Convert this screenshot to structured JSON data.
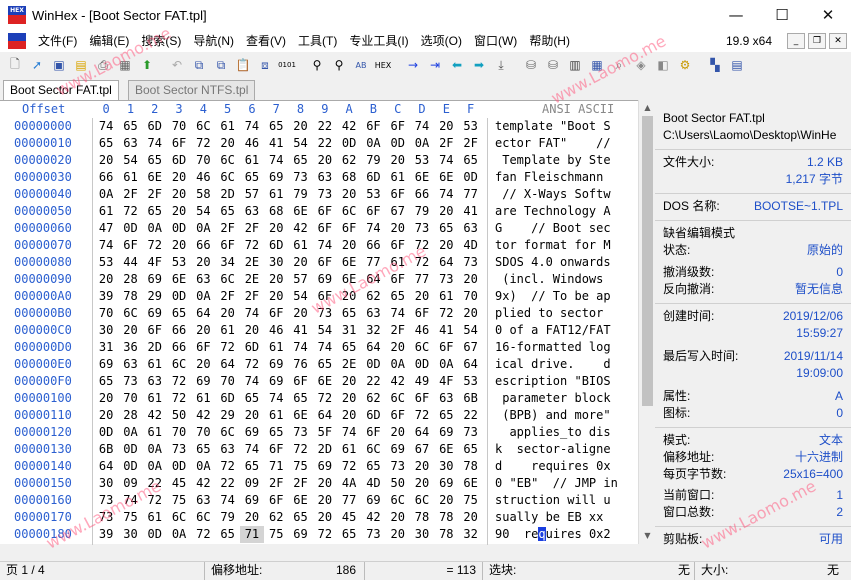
{
  "window": {
    "title": "WinHex - [Boot Sector FAT.tpl]",
    "icon_text": "HEX"
  },
  "menu": {
    "items": [
      "文件(F)",
      "编辑(E)",
      "搜索(S)",
      "导航(N)",
      "查看(V)",
      "工具(T)",
      "专业工具(I)",
      "选项(O)",
      "窗口(W)",
      "帮助(H)"
    ],
    "version": "19.9 x64"
  },
  "tabs": [
    "Boot Sector FAT.tpl",
    "Boot Sector NTFS.tpl"
  ],
  "hex": {
    "offset_header": "Offset",
    "col_headers": [
      "0",
      "1",
      "2",
      "3",
      "4",
      "5",
      "6",
      "7",
      "8",
      "9",
      "A",
      "B",
      "C",
      "D",
      "E",
      "F"
    ],
    "ansi_header": "ANSI ASCII",
    "offsets": [
      "00000000",
      "00000010",
      "00000020",
      "00000030",
      "00000040",
      "00000050",
      "00000060",
      "00000070",
      "00000080",
      "00000090",
      "000000A0",
      "000000B0",
      "000000C0",
      "000000D0",
      "000000E0",
      "000000F0",
      "00000100",
      "00000110",
      "00000120",
      "00000130",
      "00000140",
      "00000150",
      "00000160",
      "00000170",
      "00000180"
    ],
    "rows": [
      "74 65 6D 70 6C 61 74 65 20 22 42 6F 6F 74 20 53",
      "65 63 74 6F 72 20 46 41 54 22 0D 0A 0D 0A 2F 2F",
      "20 54 65 6D 70 6C 61 74 65 20 62 79 20 53 74 65",
      "66 61 6E 20 46 6C 65 69 73 63 68 6D 61 6E 6E 0D",
      "0A 2F 2F 20 58 2D 57 61 79 73 20 53 6F 66 74 77",
      "61 72 65 20 54 65 63 68 6E 6F 6C 6F 67 79 20 41",
      "47 0D 0A 0D 0A 2F 2F 20 42 6F 6F 74 20 73 65 63",
      "74 6F 72 20 66 6F 72 6D 61 74 20 66 6F 72 20 4D",
      "53 44 4F 53 20 34 2E 30 20 6F 6E 77 61 72 64 73",
      "20 28 69 6E 63 6C 2E 20 57 69 6E 64 6F 77 73 20",
      "39 78 29 0D 0A 2F 2F 20 54 6F 20 62 65 20 61 70",
      "70 6C 69 65 64 20 74 6F 20 73 65 63 74 6F 72 20",
      "30 20 6F 66 20 61 20 46 41 54 31 32 2F 46 41 54",
      "31 36 2D 66 6F 72 6D 61 74 74 65 64 20 6C 6F 67",
      "69 63 61 6C 20 64 72 69 76 65 2E 0D 0A 0D 0A 64",
      "65 73 63 72 69 70 74 69 6F 6E 20 22 42 49 4F 53",
      "20 70 61 72 61 6D 65 74 65 72 20 62 6C 6F 63 6B",
      "20 28 42 50 42 29 20 61 6E 64 20 6D 6F 72 65 22",
      "0D 0A 61 70 70 6C 69 65 73 5F 74 6F 20 64 69 73",
      "6B 0D 0A 73 65 63 74 6F 72 2D 61 6C 69 67 6E 65",
      "64 0D 0A 0D 0A 72 65 71 75 69 72 65 73 20 30 78",
      "30 09 22 45 42 22 09 2F 2F 20 4A 4D 50 20 69 6E",
      "73 74 72 75 63 74 69 6F 6E 20 77 69 6C 6C 20 75",
      "73 75 61 6C 6C 79 20 62 65 20 45 42 20 78 78 20",
      "39 30 0D 0A 72 65 71 75 69 72 65 73 20 30 78 32"
    ],
    "ascii": [
      "template \"Boot S",
      "ector FAT\"    //",
      " Template by Ste",
      "fan Fleischmann ",
      " // X-Ways Softw",
      "are Technology A",
      "G    // Boot sec",
      "tor format for M",
      "SDOS 4.0 onwards",
      " (incl. Windows ",
      "9x)  // To be ap",
      "plied to sector ",
      "0 of a FAT12/FAT",
      "16-formatted log",
      "ical drive.    d",
      "escription \"BIOS",
      " parameter block",
      " (BPB) and more\"",
      "  applies_to dis",
      "k  sector-aligne",
      "d    requires 0x",
      "0 \"EB\"  // JMP in",
      "struction will u",
      "sually be EB xx ",
      "90  requires 0x2"
    ]
  },
  "info": {
    "filename": "Boot Sector FAT.tpl",
    "path": "C:\\Users\\Laomo\\Desktop\\WinHe",
    "size_label": "文件大小:",
    "size_kb": "1.2 KB",
    "size_bytes": "1,217 字节",
    "dos_label": "DOS 名称:",
    "dos_name": "BOOTSE~1.TPL",
    "edit_mode": "缺省编辑模式",
    "state_label": "状态:",
    "state": "原始的",
    "undo_level_label": "撤消级数:",
    "undo_level": "0",
    "reverse_undo_label": "反向撤消:",
    "reverse_undo": "暂无信息",
    "created_label": "创建时间:",
    "created_date": "2019/12/06",
    "created_time": "15:59:27",
    "modified_label": "最后写入时间:",
    "modified_date": "2019/11/14",
    "modified_time": "19:09:00",
    "attr_label": "属性:",
    "attr": "A",
    "icon_label": "图标:",
    "icon": "0",
    "mode_label": "模式:",
    "mode": "文本",
    "offset_label": "偏移地址:",
    "offset": "十六进制",
    "bpp_label": "每页字节数:",
    "bpp": "25x16=400",
    "curwin_label": "当前窗口:",
    "curwin": "1",
    "totalwin_label": "窗口总数:",
    "totalwin": "2",
    "clip_label": "剪贴板:",
    "clip": "可用"
  },
  "status": {
    "page": "页 1 / 4",
    "offset_label": "偏移地址:",
    "offset_value": "186",
    "eq_value": "= 113",
    "sel_label": "选块:",
    "sel_value": "无",
    "size_label": "大小:",
    "size_value": "无"
  },
  "watermark": "www.Laomo.me"
}
